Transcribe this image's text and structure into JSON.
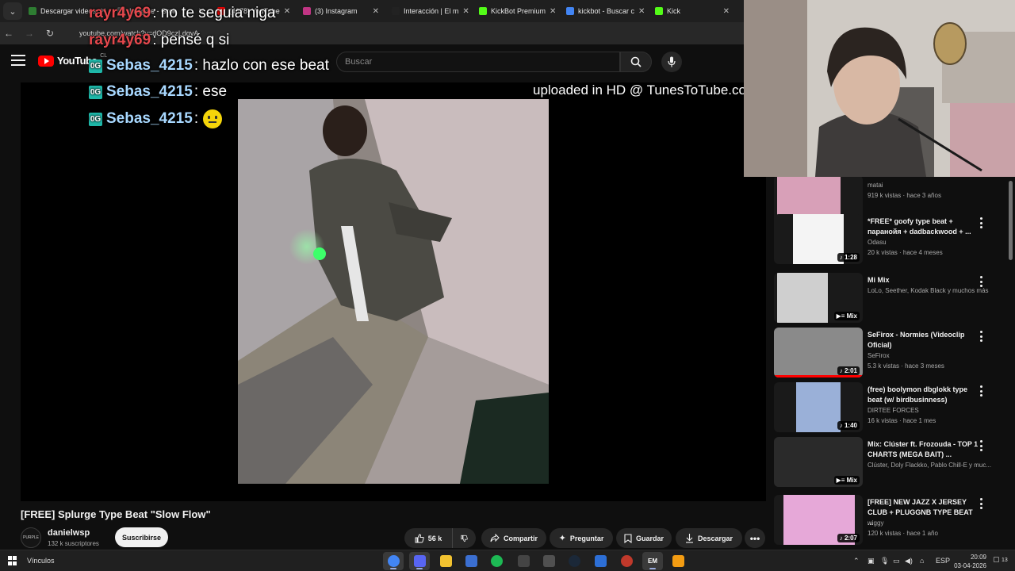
{
  "browser": {
    "tabs": [
      {
        "label": "Descargar videos",
        "icon": "download-icon",
        "color": "#2e7d32"
      },
      {
        "label": "Imagine - Grok",
        "icon": "grok-icon",
        "color": "#555555"
      },
      {
        "label": "(4678) YouTube",
        "icon": "youtube-icon",
        "color": "#ff0000"
      },
      {
        "label": "(3) Instagram",
        "icon": "instagram-icon",
        "color": "#c13584"
      },
      {
        "label": "Interacción | El m",
        "icon": "tiktok-icon",
        "color": "#222222"
      },
      {
        "label": "KickBot Premium",
        "icon": "kick-icon",
        "color": "#53fc18"
      },
      {
        "label": "kickbot - Buscar c",
        "icon": "google-icon",
        "color": "#4285f4"
      },
      {
        "label": "Kick",
        "icon": "kick-icon",
        "color": "#53fc18"
      }
    ],
    "url": "youtube.com/watch?v=dOD9czLdgyA"
  },
  "youtube": {
    "logo_text": "YouTube",
    "region": "CL",
    "search_placeholder": "Buscar"
  },
  "stream_overlay": {
    "chat": [
      {
        "user": "rayr4y69",
        "text": ": no te seguia niga",
        "user_color": "#e5484d",
        "badge": false
      },
      {
        "user": "rayr4y69",
        "text": ": pensé q si",
        "user_color": "#e5484d",
        "badge": false
      },
      {
        "user": "Sebas_4215",
        "text": ": hazlo con ese beat",
        "user_color": "#a8d8ff",
        "badge": true
      },
      {
        "user": "Sebas_4215",
        "text": ": ese",
        "user_color": "#a8d8ff",
        "badge": true
      },
      {
        "user": "Sebas_4215",
        "text": ":",
        "user_color": "#a8d8ff",
        "badge": true,
        "emoji": "neutral-face-emoji"
      }
    ],
    "badge_text": "0G",
    "uploaded_text": "uploaded in HD @ TunesToTube.com"
  },
  "video": {
    "title": "[FREE] Splurge Type Beat \"Slow Flow\"",
    "channel": "danielwsp",
    "subscribers": "132 k suscriptores",
    "subscribe_label": "Suscribirse",
    "likes": "56 k",
    "share_label": "Compartir",
    "ask_label": "Preguntar",
    "save_label": "Guardar",
    "download_label": "Descargar",
    "avatar_text": "PURPLE"
  },
  "recommendations": [
    {
      "title": "",
      "channel": "matai",
      "meta": "919 k vistas · hace 3 años",
      "duration": "3:15",
      "progress": 0.95,
      "thumb_color": "#d8a0b8"
    },
    {
      "title": "*FREE* goofy type beat + паранойя + dadbackwood + ...",
      "channel": "Odasu",
      "meta": "20 k vistas · hace 4 meses",
      "duration": "1:28",
      "progress": 0,
      "thumb_color": "#f4f4f4"
    },
    {
      "title": "Mi Mix",
      "channel": "LoLo, Seether, Kodak Black y muchos más",
      "meta": "",
      "duration": "Mix",
      "progress": 0,
      "thumb_color": "#cfcfcf"
    },
    {
      "title": "SeFirox - Normies (Videoclip Oficial)",
      "channel": "SeFirox",
      "meta": "5.3 k vistas · hace 3 meses",
      "duration": "2:01",
      "progress": 1.0,
      "thumb_color": "#8a8a8a"
    },
    {
      "title": "(free) boolymon dbglokk type beat (w/ birdbusinness)",
      "channel": "DIRTEE FORCES",
      "meta": "16 k vistas · hace 1 mes",
      "duration": "1:40",
      "progress": 0,
      "thumb_color": "#9ab0d8"
    },
    {
      "title": "Mix: Clúster ft. Frozouda - TOP 1 CHARTS (MEGA BAIT) ...",
      "channel": "Clúster, Doly Flackko, Pablo Chill-E y muc...",
      "meta": "",
      "duration": "Mix",
      "progress": 0,
      "thumb_color": "#2a2a2a"
    },
    {
      "title": "[FREE] NEW JAZZ X JERSEY CLUB + PLUGGNB TYPE BEAT ...",
      "channel": "wiggy",
      "meta": "120 k vistas · hace 1 año",
      "duration": "2:07",
      "progress": 0,
      "thumb_color": "#e6a8d8"
    }
  ],
  "taskbar": {
    "label": "Vínculos",
    "apps": [
      {
        "name": "chrome-icon",
        "color": "#4285f4",
        "glyph": "",
        "active": true
      },
      {
        "name": "discord-icon",
        "color": "#5865f2",
        "glyph": "",
        "active": true
      },
      {
        "name": "file-explorer-icon",
        "color": "#f2c230",
        "glyph": "",
        "active": false
      },
      {
        "name": "calculator-icon",
        "color": "#3b6fd1",
        "glyph": "",
        "active": false
      },
      {
        "name": "spotify-icon",
        "color": "#1db954",
        "glyph": "",
        "active": false
      },
      {
        "name": "streamlabs-icon",
        "color": "#444444",
        "glyph": "",
        "active": false
      },
      {
        "name": "obs-icon",
        "color": "#505050",
        "glyph": "",
        "active": false
      },
      {
        "name": "steam-icon",
        "color": "#1b2838",
        "glyph": "",
        "active": false
      },
      {
        "name": "app-icon",
        "color": "#2d6fd6",
        "glyph": "",
        "active": false
      },
      {
        "name": "record-icon",
        "color": "#c0392b",
        "glyph": "",
        "active": false
      },
      {
        "name": "em-icon",
        "color": "#3a3a3a",
        "glyph": "EM",
        "active": true
      },
      {
        "name": "fl-studio-icon",
        "color": "#f39c12",
        "glyph": "",
        "active": false
      }
    ],
    "language": "ESP",
    "time": "20:09",
    "date": "03-04-2026",
    "notifications": "13"
  }
}
